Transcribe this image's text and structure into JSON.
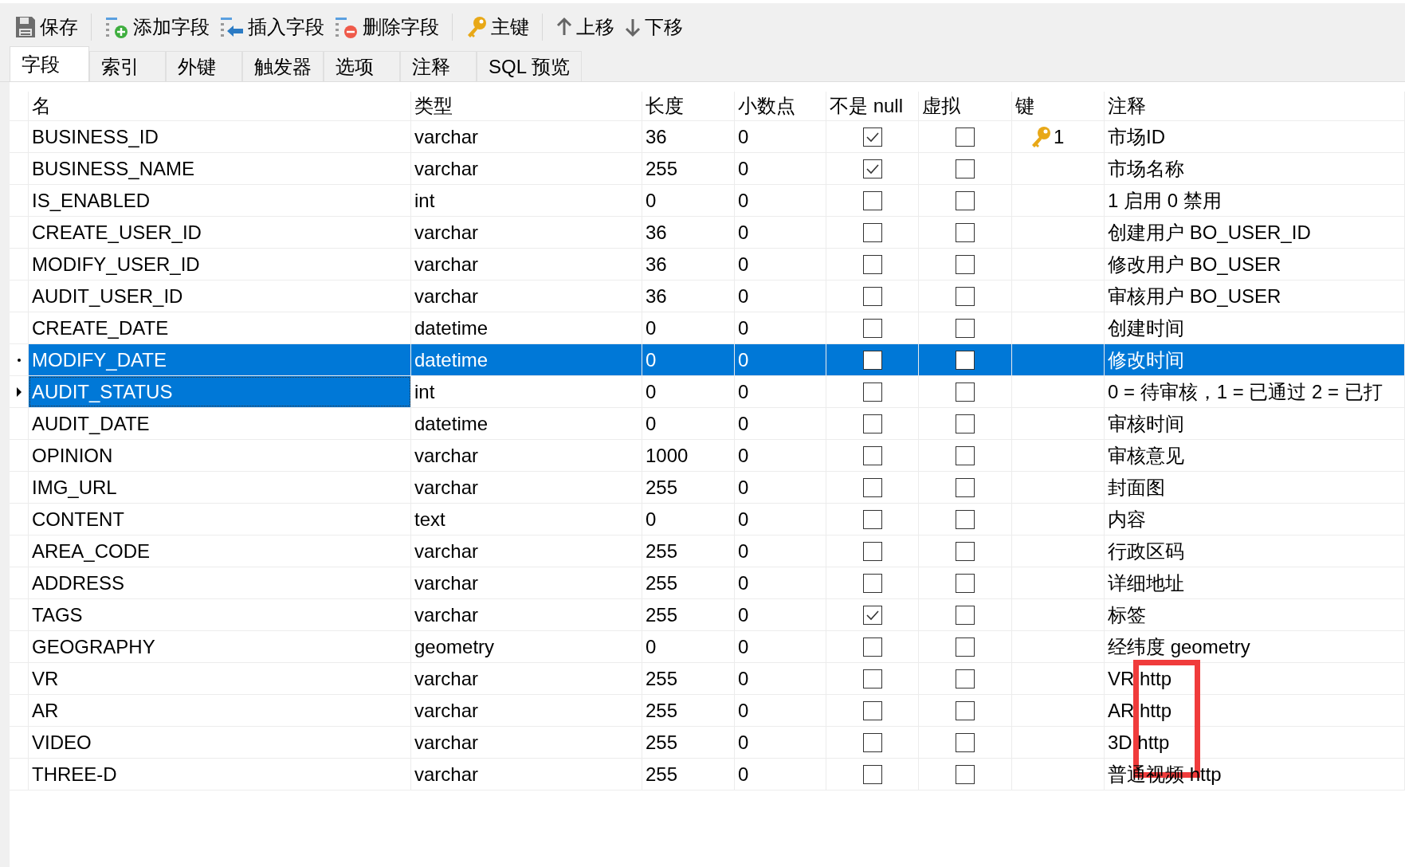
{
  "toolbar": [
    {
      "kind": "save",
      "label": "保存"
    },
    {
      "kind": "add",
      "label": "添加字段"
    },
    {
      "kind": "insert",
      "label": "插入字段"
    },
    {
      "kind": "delete",
      "label": "删除字段"
    },
    {
      "kind": "key",
      "label": "主键"
    },
    {
      "kind": "up",
      "label": "上移"
    },
    {
      "kind": "down",
      "label": "下移"
    }
  ],
  "tabs": [
    {
      "label": "字段",
      "selected": true
    },
    {
      "label": "索引",
      "selected": false
    },
    {
      "label": "外键",
      "selected": false
    },
    {
      "label": "触发器",
      "selected": false
    },
    {
      "label": "选项",
      "selected": false
    },
    {
      "label": "注释",
      "selected": false
    },
    {
      "label": "SQL 预览",
      "selected": false
    }
  ],
  "table": {
    "columns": [
      "名",
      "类型",
      "长度",
      "小数点",
      "不是 null",
      "虚拟",
      "键",
      "注释"
    ],
    "rows": [
      {
        "name": "BUSINESS_ID",
        "type": "varchar",
        "length": "36",
        "decimals": "0",
        "not_null": true,
        "virtual": false,
        "key": "1",
        "comment": "市场ID",
        "selected": false,
        "focused": false,
        "highlighted": false
      },
      {
        "name": "BUSINESS_NAME",
        "type": "varchar",
        "length": "255",
        "decimals": "0",
        "not_null": true,
        "virtual": false,
        "comment": "市场名称",
        "selected": false,
        "focused": false,
        "highlighted": false
      },
      {
        "name": "IS_ENABLED",
        "type": "int",
        "length": "0",
        "decimals": "0",
        "not_null": false,
        "virtual": false,
        "comment": "1 启用  0 禁用",
        "selected": false,
        "focused": false,
        "highlighted": false
      },
      {
        "name": "CREATE_USER_ID",
        "type": "varchar",
        "length": "36",
        "decimals": "0",
        "not_null": false,
        "virtual": false,
        "comment": "创建用户 BO_USER_ID",
        "selected": false,
        "focused": false,
        "highlighted": false
      },
      {
        "name": "MODIFY_USER_ID",
        "type": "varchar",
        "length": "36",
        "decimals": "0",
        "not_null": false,
        "virtual": false,
        "comment": "修改用户 BO_USER",
        "selected": false,
        "focused": false,
        "highlighted": false
      },
      {
        "name": "AUDIT_USER_ID",
        "type": "varchar",
        "length": "36",
        "decimals": "0",
        "not_null": false,
        "virtual": false,
        "comment": "审核用户 BO_USER",
        "selected": false,
        "focused": false,
        "highlighted": false
      },
      {
        "name": "CREATE_DATE",
        "type": "datetime",
        "length": "0",
        "decimals": "0",
        "not_null": false,
        "virtual": false,
        "comment": "创建时间",
        "selected": false,
        "focused": false,
        "highlighted": false
      },
      {
        "name": "MODIFY_DATE",
        "type": "datetime",
        "length": "0",
        "decimals": "0",
        "not_null": false,
        "virtual": false,
        "comment": "修改时间",
        "selected": true,
        "focused": false,
        "highlighted": false
      },
      {
        "name": "AUDIT_STATUS",
        "type": "int",
        "length": "0",
        "decimals": "0",
        "not_null": false,
        "virtual": false,
        "comment": "0 = 待审核，1 = 已通过 2 = 已打",
        "selected": false,
        "focused": true,
        "highlighted": false
      },
      {
        "name": "AUDIT_DATE",
        "type": "datetime",
        "length": "0",
        "decimals": "0",
        "not_null": false,
        "virtual": false,
        "comment": "审核时间",
        "selected": false,
        "focused": false,
        "highlighted": false
      },
      {
        "name": "OPINION",
        "type": "varchar",
        "length": "1000",
        "decimals": "0",
        "not_null": false,
        "virtual": false,
        "comment": "审核意见",
        "selected": false,
        "focused": false,
        "highlighted": false
      },
      {
        "name": "IMG_URL",
        "type": "varchar",
        "length": "255",
        "decimals": "0",
        "not_null": false,
        "virtual": false,
        "comment": "封面图",
        "selected": false,
        "focused": false,
        "highlighted": false
      },
      {
        "name": "CONTENT",
        "type": "text",
        "length": "0",
        "decimals": "0",
        "not_null": false,
        "virtual": false,
        "comment": "内容",
        "selected": false,
        "focused": false,
        "highlighted": false
      },
      {
        "name": "AREA_CODE",
        "type": "varchar",
        "length": "255",
        "decimals": "0",
        "not_null": false,
        "virtual": false,
        "comment": "行政区码",
        "selected": false,
        "focused": false,
        "highlighted": false
      },
      {
        "name": "ADDRESS",
        "type": "varchar",
        "length": "255",
        "decimals": "0",
        "not_null": false,
        "virtual": false,
        "comment": "详细地址",
        "selected": false,
        "focused": false,
        "highlighted": false
      },
      {
        "name": "TAGS",
        "type": "varchar",
        "length": "255",
        "decimals": "0",
        "not_null": true,
        "virtual": false,
        "comment": "标签",
        "selected": false,
        "focused": false,
        "highlighted": false
      },
      {
        "name": "GEOGRAPHY",
        "type": "geometry",
        "length": "0",
        "decimals": "0",
        "not_null": false,
        "virtual": false,
        "comment": "经纬度 geometry",
        "selected": false,
        "focused": false,
        "highlighted": false
      },
      {
        "name": "VR",
        "type": "varchar",
        "length": "255",
        "decimals": "0",
        "not_null": false,
        "virtual": false,
        "comment": "VR http",
        "selected": false,
        "focused": false,
        "highlighted": true
      },
      {
        "name": "AR",
        "type": "varchar",
        "length": "255",
        "decimals": "0",
        "not_null": false,
        "virtual": false,
        "comment": "AR http",
        "selected": false,
        "focused": false,
        "highlighted": true
      },
      {
        "name": "VIDEO",
        "type": "varchar",
        "length": "255",
        "decimals": "0",
        "not_null": false,
        "virtual": false,
        "comment": "3D http",
        "selected": false,
        "focused": false,
        "highlighted": true
      },
      {
        "name": "THREE-D",
        "type": "varchar",
        "length": "255",
        "decimals": "0",
        "not_null": false,
        "virtual": false,
        "comment": "普通视频 http",
        "selected": false,
        "focused": false,
        "highlighted": false
      }
    ]
  }
}
